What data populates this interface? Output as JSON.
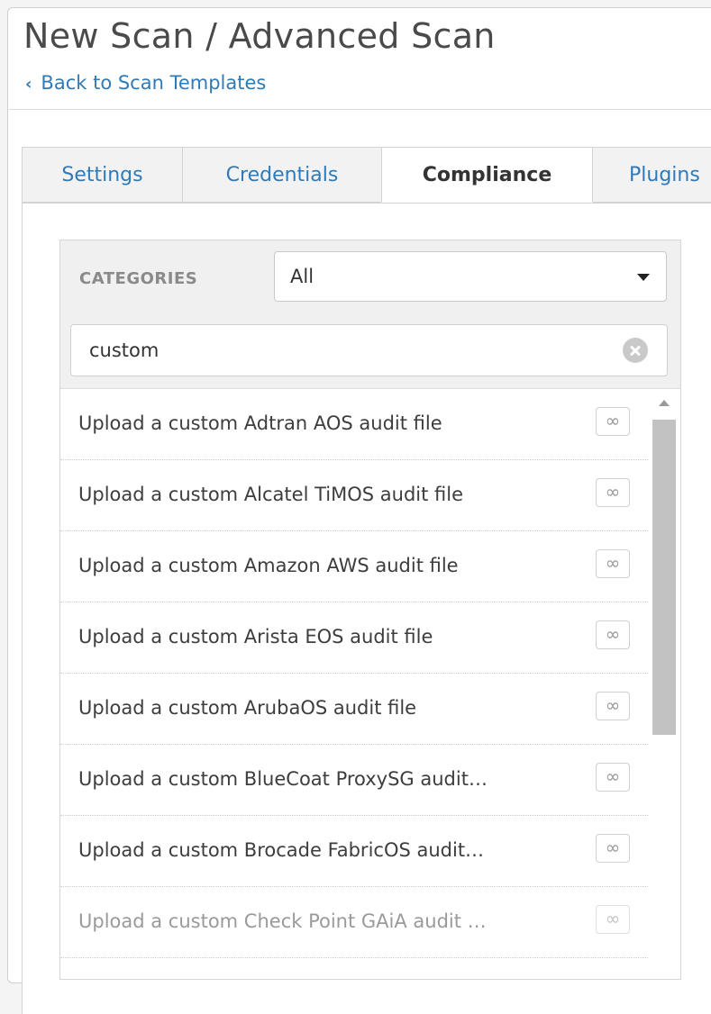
{
  "header": {
    "title": "New Scan / Advanced Scan",
    "back_chevron": "‹",
    "back_label": "Back to Scan Templates"
  },
  "tabs": [
    {
      "label": "Settings",
      "active": false
    },
    {
      "label": "Credentials",
      "active": false
    },
    {
      "label": "Compliance",
      "active": true
    },
    {
      "label": "Plugins",
      "active": false
    }
  ],
  "compliance": {
    "categories_label": "CATEGORIES",
    "category_selected": "All",
    "search_value": "custom",
    "link_glyph": "∞",
    "items": [
      {
        "label": "Upload a custom Adtran AOS audit file"
      },
      {
        "label": "Upload a custom Alcatel TiMOS audit file"
      },
      {
        "label": "Upload a custom Amazon AWS audit file"
      },
      {
        "label": "Upload a custom Arista EOS audit file"
      },
      {
        "label": "Upload a custom ArubaOS audit file"
      },
      {
        "label": "Upload a custom BlueCoat ProxySG audit…"
      },
      {
        "label": "Upload a custom Brocade FabricOS audit…"
      },
      {
        "label": "Upload a custom Check Point GAiA audit …"
      }
    ]
  },
  "colors": {
    "link_blue": "#2f7ab8",
    "tab_bg": "#f2f2f2",
    "panel_bar_bg": "#f0f0f0"
  }
}
